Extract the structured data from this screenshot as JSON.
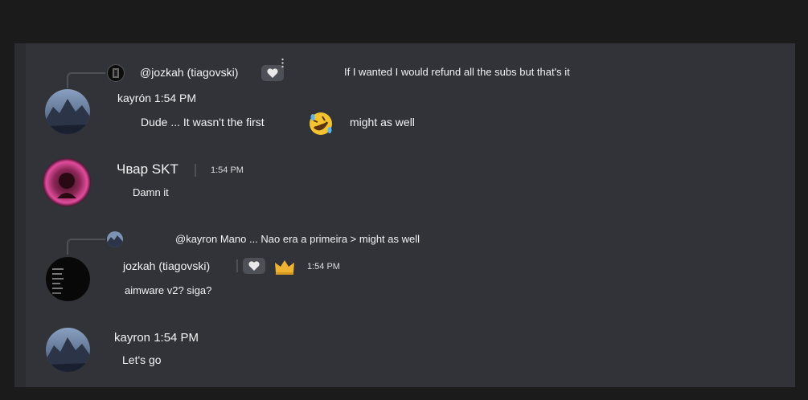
{
  "messages": {
    "reply1": {
      "reply_user": "@jozkah (tiagovski)",
      "reply_text": "If I wanted I would refund all the subs but that's it"
    },
    "m1": {
      "author_time": "kayrón 1:54 PM",
      "text_before": "Dude ... It wasn't the first",
      "emoji": "rolling-on-floor-laughing-emoji",
      "text_after": "might as well"
    },
    "m2": {
      "author": "Чвар SKT",
      "time": "1:54 PM",
      "text": "Damn it"
    },
    "reply2": {
      "reply_text": "@kayron Mano ... Nao era a primeira > might as well"
    },
    "m3": {
      "author": "jozkah (tiagovski)",
      "time": "1:54 PM",
      "text": "aimware v2? siga?"
    },
    "m4": {
      "author_time": "kayron 1:54 PM",
      "text": "Let's go"
    }
  },
  "colors": {
    "background": "#1b1b1c",
    "chat": "#313338",
    "text": "#f2f3f5",
    "crown": "#f0b232"
  }
}
